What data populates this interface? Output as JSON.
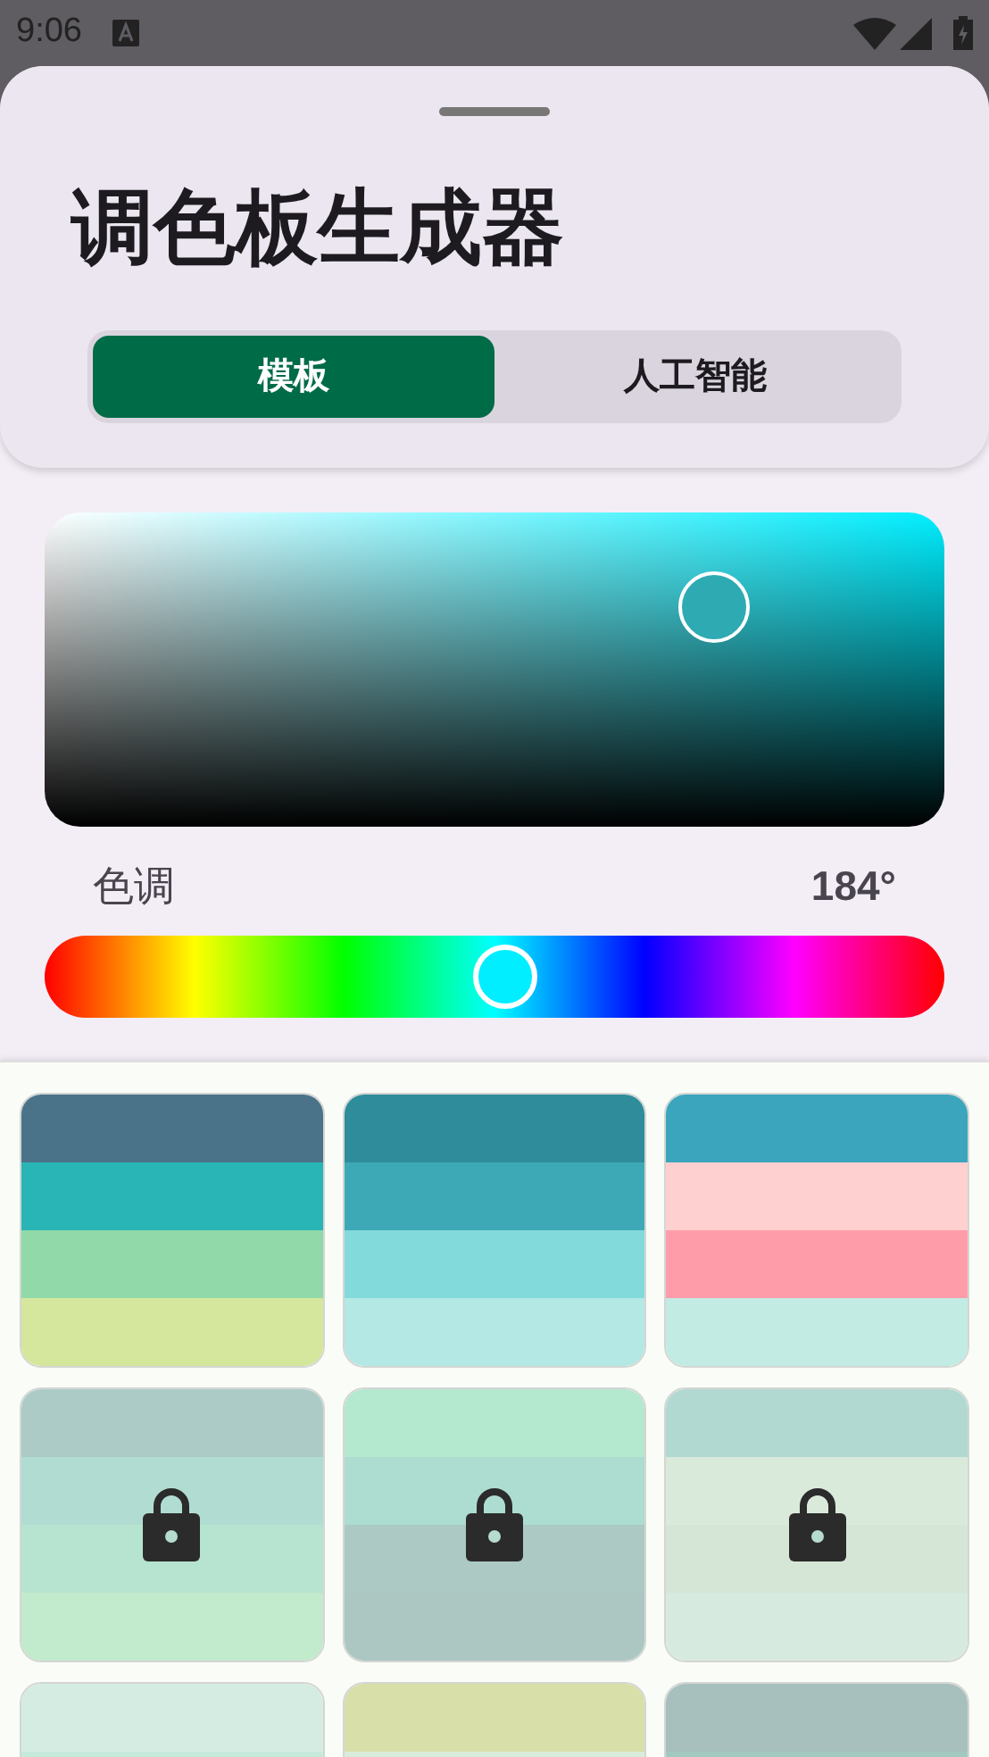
{
  "status_bar": {
    "time": "9:06"
  },
  "sheet": {
    "title": "调色板生成器",
    "tabs": [
      {
        "label": "模板",
        "selected": true
      },
      {
        "label": "人工智能",
        "selected": false
      }
    ]
  },
  "color_picker": {
    "saturation": {
      "level": 0.744
    },
    "brightness": {
      "level": 0.7
    },
    "hue": {
      "label": "色调",
      "reading": "184°",
      "level": 0.511
    }
  },
  "palettes": [
    {
      "locked": false,
      "colors": [
        {
          "color": "#4a7389"
        },
        {
          "color": "#29b4b6"
        },
        {
          "color": "#91d9a9"
        },
        {
          "color": "#d4e79c"
        }
      ]
    },
    {
      "locked": false,
      "colors": [
        {
          "color": "#2e8c9b"
        },
        {
          "color": "#3ea9b6"
        },
        {
          "color": "#83dada"
        },
        {
          "color": "#b4e8e4"
        }
      ]
    },
    {
      "locked": false,
      "colors": [
        {
          "color": "#3aa5bc"
        },
        {
          "color": "#ffd0d0"
        },
        {
          "color": "#ff9ca9"
        },
        {
          "color": "#c1ebe3"
        }
      ]
    },
    {
      "locked": true,
      "colors": [
        {
          "color": "#adcbc6"
        },
        {
          "color": "#b1dcd2"
        },
        {
          "color": "#b6e4d0"
        },
        {
          "color": "#c2eacc"
        }
      ]
    },
    {
      "locked": true,
      "colors": [
        {
          "color": "#b4e8cf"
        },
        {
          "color": "#addcd0"
        },
        {
          "color": "#acc9c3"
        },
        {
          "color": "#acc6c2"
        }
      ]
    },
    {
      "locked": true,
      "colors": [
        {
          "color": "#b2d9d1"
        },
        {
          "color": "#d9eadb"
        },
        {
          "color": "#d5e6d6"
        },
        {
          "color": "#d7eadf"
        }
      ]
    },
    {
      "locked": false,
      "colors": [
        {
          "color": "#d5ece2"
        },
        {
          "color": "#c5eadc"
        }
      ]
    },
    {
      "locked": false,
      "colors": [
        {
          "color": "#d8dfa8"
        },
        {
          "color": "#d9ecdc"
        }
      ]
    },
    {
      "locked": false,
      "colors": [
        {
          "color": "#a7c0bd"
        },
        {
          "color": "#a2c9c0"
        }
      ]
    }
  ]
}
